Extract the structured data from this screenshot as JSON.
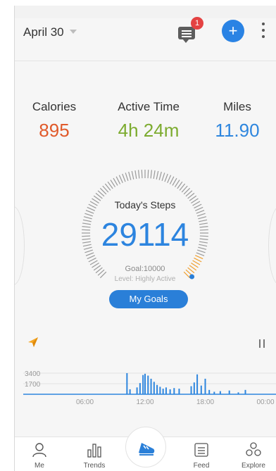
{
  "header": {
    "date": "April 30",
    "badge_count": "1"
  },
  "stats": [
    {
      "label": "Calories",
      "value": "895",
      "color": "#e05a2b"
    },
    {
      "label": "Active Time",
      "value": "4h 24m",
      "color": "#7cab2f"
    },
    {
      "label": "Miles",
      "value": "11.90",
      "color": "#2e86de"
    }
  ],
  "dial": {
    "title": "Today's Steps",
    "steps": "29114",
    "goal": "Goal:10000",
    "level": "Level: Highly Active",
    "button": "My Goals"
  },
  "chart_data": {
    "type": "bar",
    "y_ticks": [
      "3400",
      "1700"
    ],
    "x_ticks": [
      "06:00",
      "12:00",
      "18:00",
      "00:00"
    ],
    "x": [
      10.2,
      10.5,
      11.2,
      11.5,
      11.8,
      12.0,
      12.3,
      12.6,
      12.9,
      13.2,
      13.5,
      13.8,
      14.1,
      14.5,
      14.9,
      15.4,
      16.6,
      16.9,
      17.2,
      17.6,
      18.0,
      18.4,
      18.9,
      19.5,
      20.4,
      21.3,
      22.0
    ],
    "values": [
      3400,
      800,
      1100,
      1800,
      3100,
      3300,
      3000,
      2500,
      2000,
      1500,
      1200,
      900,
      1100,
      800,
      1000,
      900,
      1300,
      1900,
      3200,
      1400,
      2500,
      700,
      400,
      500,
      600,
      300,
      700
    ],
    "color": "#2e86de"
  },
  "tabs": [
    {
      "label": "Me",
      "icon": "person-icon"
    },
    {
      "label": "Trends",
      "icon": "bar-chart-icon"
    },
    {
      "label": "",
      "icon": "shoe-icon"
    },
    {
      "label": "Feed",
      "icon": "feed-icon"
    },
    {
      "label": "Explore",
      "icon": "explore-icon"
    }
  ]
}
